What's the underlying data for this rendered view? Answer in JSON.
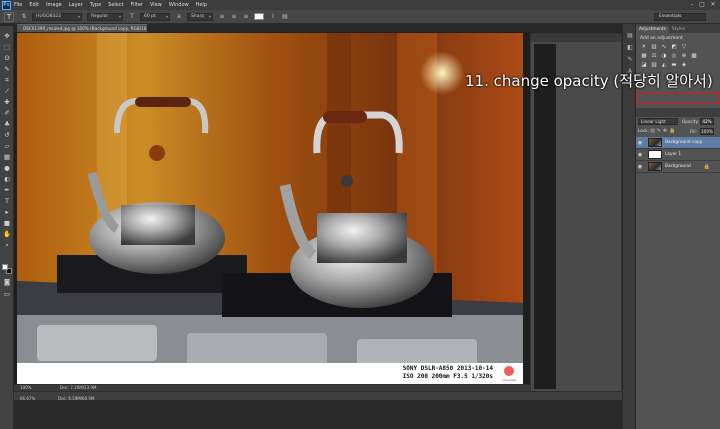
{
  "app": {
    "logo": "Ps"
  },
  "menu": [
    "File",
    "Edit",
    "Image",
    "Layer",
    "Type",
    "Select",
    "Filter",
    "View",
    "Window",
    "Help"
  ],
  "options": {
    "tool_glyph": "T",
    "font_family": "HUGO8322",
    "font_style": "Regular",
    "font_size": "60 pt",
    "antialias": "Sharp",
    "workspace": "Essentials"
  },
  "document": {
    "tab_title": "DSC01390_resized.jpg @ 100% (Background copy, RGB/16) *",
    "zoom": "100%",
    "doc_size": "Doc: 7.26M/23.9M",
    "zoom2": "66.67%",
    "doc_size2": "Doc: 6.59M/60.9M"
  },
  "photo": {
    "caption_line1": "SONY DSLR-A850 2013-10-14",
    "caption_line2": "ISO 200 200mm F3.5 1/320s",
    "badge": "Loveshell"
  },
  "annotation": "11. change opacity (적당히 알아서)",
  "panels": {
    "adjustments_tab": "Adjustments",
    "styles_tab": "Styles",
    "add_adjustment": "Add an adjustment",
    "blend_mode": "Linear Light",
    "opacity_label": "Opacity:",
    "opacity_value": "42%",
    "lock_label": "Lock:",
    "fill_label": "Fill:",
    "fill_value": "100%",
    "layers": [
      {
        "name": "Background copy",
        "selected": true
      },
      {
        "name": "Layer 1",
        "selected": false
      },
      {
        "name": "Background",
        "selected": false
      }
    ]
  },
  "colors": {
    "highlight": "#e01a1a",
    "selection": "#5e7ea6"
  }
}
